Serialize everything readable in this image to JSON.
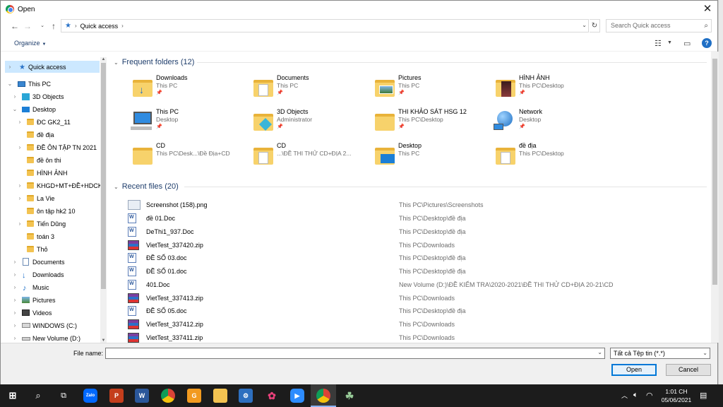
{
  "window": {
    "title": "Open",
    "close_icon": "close-icon"
  },
  "address": {
    "path": [
      "Quick access"
    ],
    "search_placeholder": "Search Quick access"
  },
  "toolbar": {
    "organize_label": "Organize"
  },
  "nav": [
    {
      "label": "Quick access"
    },
    {
      "label": "This PC"
    },
    {
      "label": "3D Objects"
    },
    {
      "label": "Desktop"
    },
    {
      "label": "ĐC GK2_11"
    },
    {
      "label": "đề địa"
    },
    {
      "label": "ĐỀ ÔN TẬP TN 2021"
    },
    {
      "label": "đề ôn thi"
    },
    {
      "label": "HÌNH ẢNH"
    },
    {
      "label": "KHGD+MT+ĐỀ+HDCK"
    },
    {
      "label": "La Vie"
    },
    {
      "label": "ôn tập hk2 10"
    },
    {
      "label": "Tiến Dũng"
    },
    {
      "label": "toán 3"
    },
    {
      "label": "Thỏ"
    },
    {
      "label": "Documents"
    },
    {
      "label": "Downloads"
    },
    {
      "label": "Music"
    },
    {
      "label": "Pictures"
    },
    {
      "label": "Videos"
    },
    {
      "label": "WINDOWS (C:)"
    },
    {
      "label": "New Volume (D:)"
    }
  ],
  "frequent": {
    "header": "Frequent folders (12)",
    "items": [
      {
        "name": "Downloads",
        "sub": "This PC"
      },
      {
        "name": "Documents",
        "sub": "This PC"
      },
      {
        "name": "Pictures",
        "sub": "This PC"
      },
      {
        "name": "HÌNH ẢNH",
        "sub": "This PC\\Desktop"
      },
      {
        "name": "This PC",
        "sub": "Desktop"
      },
      {
        "name": "3D Objects",
        "sub": "Administrator"
      },
      {
        "name": "THI KHẢO SÁT HSG 12",
        "sub": "This PC\\Desktop"
      },
      {
        "name": "Network",
        "sub": "Desktop"
      },
      {
        "name": "CD",
        "sub": "This PC\\Desk...\\Đề Địa+CD"
      },
      {
        "name": "CD",
        "sub": "...\\ĐỀ THI THỬ CD+ĐỊA 2..."
      },
      {
        "name": "Desktop",
        "sub": "This PC"
      },
      {
        "name": "đề địa",
        "sub": "This PC\\Desktop"
      }
    ]
  },
  "recent": {
    "header": "Recent files (20)",
    "items": [
      {
        "name": "Screenshot (158).png",
        "path": "This PC\\Pictures\\Screenshots",
        "kind": "png"
      },
      {
        "name": "đề 01.Doc",
        "path": "This PC\\Desktop\\đề địa",
        "kind": "doc"
      },
      {
        "name": "DeThi1_937.Doc",
        "path": "This PC\\Desktop\\đề địa",
        "kind": "doc"
      },
      {
        "name": "VietTest_337420.zip",
        "path": "This PC\\Downloads",
        "kind": "zip"
      },
      {
        "name": "ĐỀ SỐ 03.doc",
        "path": "This PC\\Desktop\\đề địa",
        "kind": "doc"
      },
      {
        "name": "ĐỀ SỐ 01.doc",
        "path": "This PC\\Desktop\\đề địa",
        "kind": "doc"
      },
      {
        "name": "401.Doc",
        "path": "New Volume (D:)\\ĐỀ KIỂM TRA\\2020-2021\\ĐỀ THI THỬ CD+ĐỊA 20-21\\CD",
        "kind": "doc"
      },
      {
        "name": "VietTest_337413.zip",
        "path": "This PC\\Downloads",
        "kind": "zip"
      },
      {
        "name": "ĐỀ SỐ 05.doc",
        "path": "This PC\\Desktop\\đề địa",
        "kind": "doc"
      },
      {
        "name": "VietTest_337412.zip",
        "path": "This PC\\Downloads",
        "kind": "zip"
      },
      {
        "name": "VietTest_337411.zip",
        "path": "This PC\\Downloads",
        "kind": "zip"
      }
    ]
  },
  "bottom": {
    "filename_label": "File name:",
    "filename_value": "",
    "filter_value": "Tất cả Tệp tin (*.*)",
    "open_label": "Open",
    "cancel_label": "Cancel"
  },
  "taskbar": {
    "time": "1:01 CH",
    "date": "05/06/2021"
  }
}
